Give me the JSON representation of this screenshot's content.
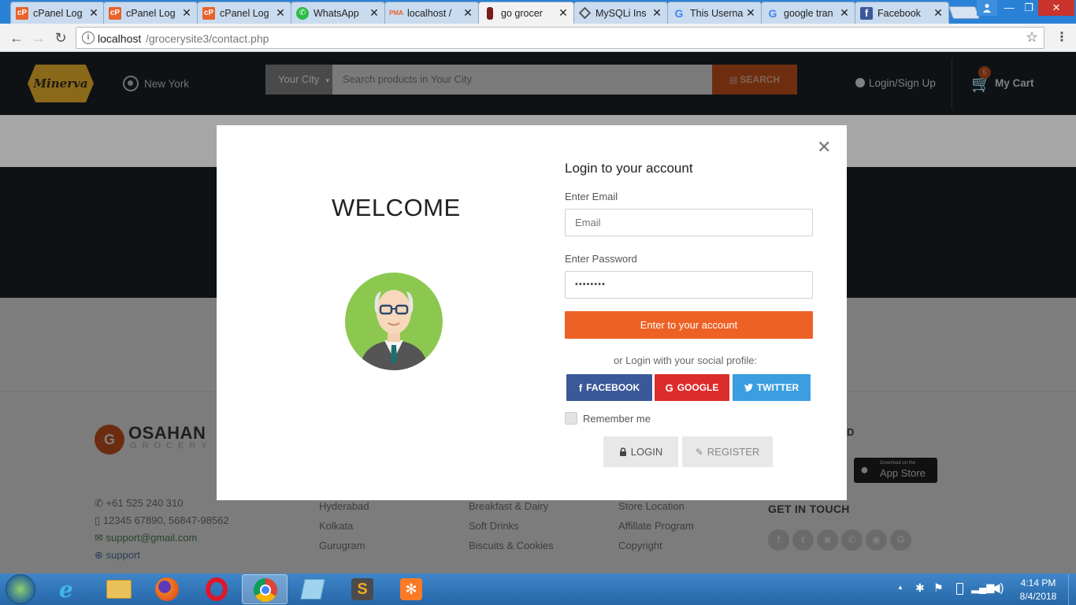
{
  "browser": {
    "tabs": [
      {
        "title": "cPanel Log",
        "icon": "cpanel-icon"
      },
      {
        "title": "cPanel Log",
        "icon": "cpanel-icon"
      },
      {
        "title": "cPanel Log",
        "icon": "cpanel-icon"
      },
      {
        "title": "WhatsApp",
        "icon": "whatsapp-icon"
      },
      {
        "title": "localhost /",
        "icon": "phpmyadmin-icon"
      },
      {
        "title": "go grocer",
        "icon": "bottle-icon",
        "active": true
      },
      {
        "title": "MySQLi Ins",
        "icon": "diamond-icon"
      },
      {
        "title": "This Userna",
        "icon": "google-icon"
      },
      {
        "title": "google tran",
        "icon": "google-icon"
      },
      {
        "title": "Facebook",
        "icon": "facebook-icon"
      }
    ],
    "close_glyph": "✕",
    "url_host": "localhost",
    "url_path": "/grocerysite3/contact.php"
  },
  "site": {
    "logo_text": "Minerva",
    "location": "New York",
    "city_placeholder": "Your City",
    "search_placeholder": "Search products in Your City",
    "search_button": "SEARCH",
    "login_link": "Login/Sign Up",
    "cart_label": "My Cart",
    "cart_count": "5"
  },
  "footer": {
    "brand_name": "OSAHAN",
    "brand_sub": "GROCERY",
    "contacts": [
      "+61 525 240 310",
      "12345 67890, 56847-98562",
      "support@gmail.com",
      "support"
    ],
    "cities": [
      "Hyderabad",
      "Kolkata",
      "Gurugram"
    ],
    "categories": [
      "Breakfast & Dairy",
      "Soft Drinks",
      "Biscuits & Cookies"
    ],
    "links": [
      "Store Location",
      "Affillate Program",
      "Copyright"
    ],
    "app_store_small": "Download on the",
    "app_store_big": "App Store",
    "get_in_touch": "GET IN TOUCH",
    "download_heading_fragment": "D",
    "social_icons": [
      "f",
      "t",
      "◙",
      "✆",
      "◉",
      "G"
    ]
  },
  "modal": {
    "welcome": "WELCOME",
    "heading": "Login to your account",
    "email_label": "Enter Email",
    "email_placeholder": "Email",
    "password_label": "Enter Password",
    "password_value": "••••••••",
    "submit": "Enter to your account",
    "social_text": "or Login with your social profile:",
    "facebook": "FACEBOOK",
    "google": "GOOGLE",
    "twitter": "TWITTER",
    "remember": "Remember me",
    "login": "LOGIN",
    "register": "REGISTER",
    "close_glyph": "✕"
  },
  "taskbar": {
    "time": "4:14 PM",
    "date": "8/4/2018"
  },
  "colors": {
    "accent": "#ee6124",
    "facebook": "#3b5998",
    "google": "#dd2c2c",
    "twitter": "#3a9ee0"
  }
}
